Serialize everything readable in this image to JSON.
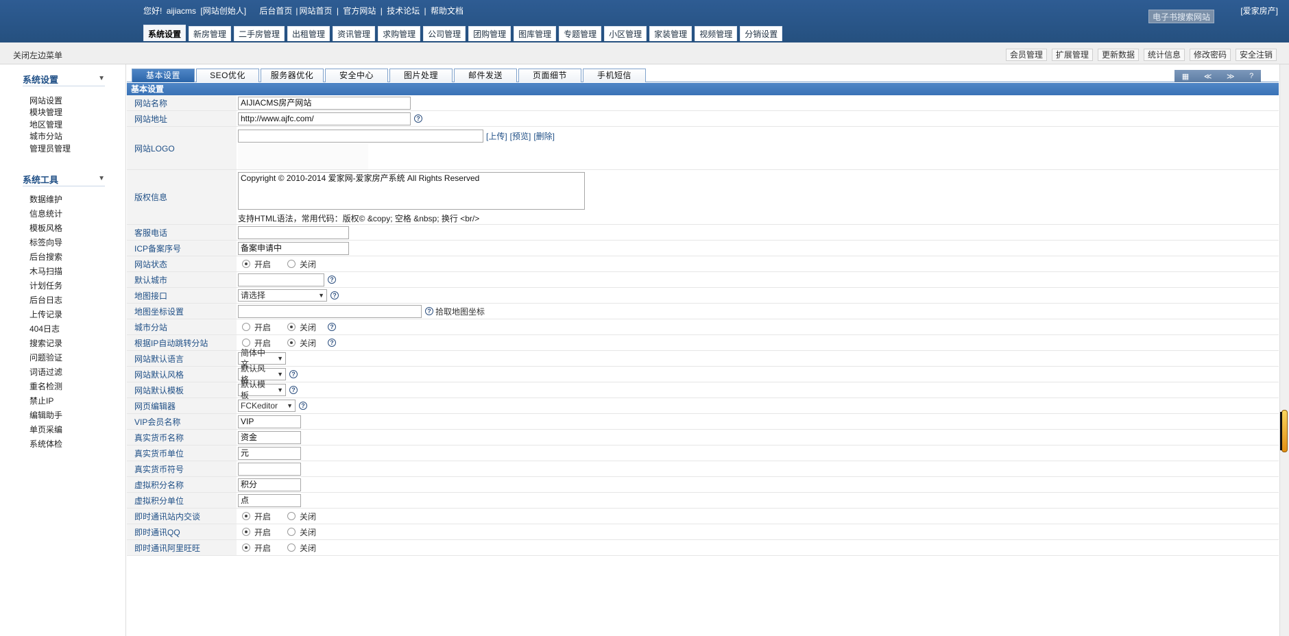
{
  "header": {
    "greeting": "您好!",
    "user": "aijiacms",
    "role": "[网站创始人]",
    "links": [
      "后台首页",
      "|",
      "网站首页",
      "|",
      "官方网站",
      "|",
      "技术论坛",
      "|",
      "帮助文档"
    ],
    "search_placeholder": "电子书搜索网站",
    "brand": "[爱家房产]",
    "nav": [
      "系统设置",
      "新房管理",
      "二手房管理",
      "出租管理",
      "资讯管理",
      "求购管理",
      "公司管理",
      "团购管理",
      "图库管理",
      "专题管理",
      "小区管理",
      "家装管理",
      "视频管理",
      "分销设置"
    ]
  },
  "toolbar": {
    "close_menu": "关闭左边菜单",
    "right": [
      "会员管理",
      "扩展管理",
      "更新数据",
      "统计信息",
      "修改密码",
      "安全注销"
    ]
  },
  "sidebar": {
    "group1": "系统设置",
    "items1": [
      "网站设置",
      "模块管理",
      "地区管理",
      "城市分站",
      "管理员管理"
    ],
    "group2": "系统工具",
    "items2": [
      "数据维护",
      "信息统计",
      "模板风格",
      "标签向导",
      "后台搜索",
      "木马扫描",
      "计划任务",
      "后台日志",
      "上传记录",
      "404日志",
      "搜索记录",
      "问题验证",
      "词语过滤",
      "重名检测",
      "禁止IP",
      "编辑助手",
      "单页采编",
      "系统体检"
    ]
  },
  "tabs": [
    "基本设置",
    "SEO优化",
    "服务器优化",
    "安全中心",
    "图片处理",
    "邮件发送",
    "页面细节",
    "手机短信"
  ],
  "tab_controls": [
    "▦",
    "≪",
    "≫",
    "?"
  ],
  "section_title": "基本设置",
  "form": {
    "site_name": {
      "label": "网站名称",
      "value": "AIJIACMS房产网站"
    },
    "site_url": {
      "label": "网站地址",
      "value": "http://www.ajfc.com/"
    },
    "logo": {
      "label": "网站LOGO",
      "value": "",
      "links": [
        "[上传]",
        "[预览]",
        "[删除]"
      ]
    },
    "copyright": {
      "label": "版权信息",
      "value": "Copyright © 2010-2014 爱家网-爱家房产系统 All Rights Reserved",
      "hint": "支持HTML语法，常用代码：版权© &copy; 空格 &nbsp; 换行 <br/>"
    },
    "phone": {
      "label": "客服电话",
      "value": ""
    },
    "icp": {
      "label": "ICP备案序号",
      "value": "备案申请中"
    },
    "status": {
      "label": "网站状态",
      "on": "开启",
      "off": "关闭"
    },
    "default_city": {
      "label": "默认城市",
      "value": ""
    },
    "map_api": {
      "label": "地图接口",
      "value": "请选择"
    },
    "map_coord": {
      "label": "地图坐标设置",
      "value": "",
      "pick": "拾取地图坐标"
    },
    "city_site": {
      "label": "城市分站",
      "on": "开启",
      "off": "关闭"
    },
    "ip_jump": {
      "label": "根据IP自动跳转分站",
      "on": "开启",
      "off": "关闭"
    },
    "lang": {
      "label": "网站默认语言",
      "value": "简体中文"
    },
    "style": {
      "label": "网站默认风格",
      "value": "默认风格"
    },
    "template": {
      "label": "网站默认模板",
      "value": "默认模板"
    },
    "editor": {
      "label": "网页编辑器",
      "value": "FCKeditor"
    },
    "vip_name": {
      "label": "VIP会员名称",
      "value": "VIP"
    },
    "money_name": {
      "label": "真实货币名称",
      "value": "资金"
    },
    "money_unit": {
      "label": "真实货币单位",
      "value": "元"
    },
    "money_symbol": {
      "label": "真实货币符号",
      "value": ""
    },
    "credit_name": {
      "label": "虚拟积分名称",
      "value": "积分"
    },
    "credit_unit": {
      "label": "虚拟积分单位",
      "value": "点"
    },
    "im_site": {
      "label": "即时通讯站内交谈",
      "on": "开启",
      "off": "关闭"
    },
    "im_qq": {
      "label": "即时通讯QQ",
      "on": "开启",
      "off": "关闭"
    },
    "im_ww": {
      "label": "即时通讯阿里旺旺",
      "on": "开启",
      "off": "关闭"
    }
  }
}
